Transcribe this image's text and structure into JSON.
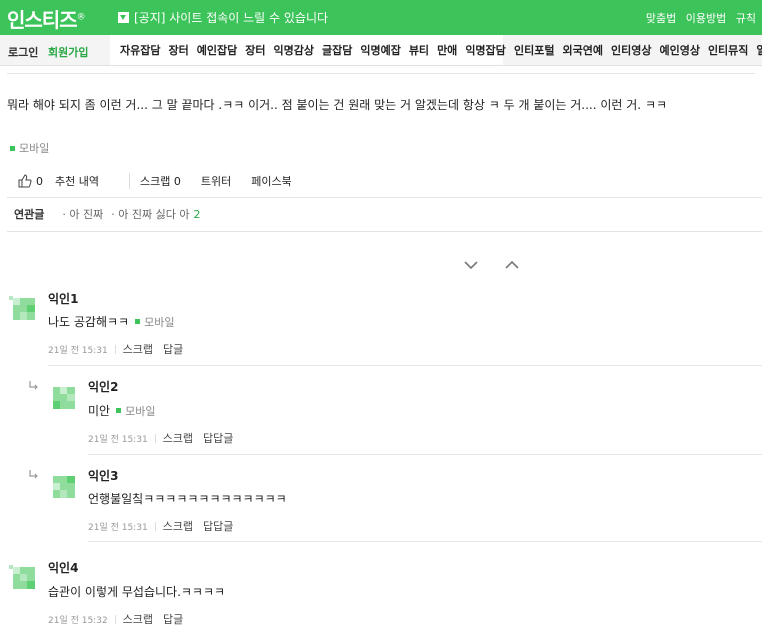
{
  "header": {
    "logo": "인스티즈",
    "logo_mark": "®",
    "notice": "[공지] 사이트 접속이 느릴 수 있습니다",
    "links": [
      "맞춤법",
      "이용방법",
      "규칙"
    ]
  },
  "nav": {
    "login": "로그인",
    "join": "회원가입",
    "menu": [
      "자유잡담",
      "장터",
      "예인잡담",
      "장터",
      "익명감상",
      "글잡담",
      "익명예잡",
      "뷰티",
      "만애",
      "익명잡담"
    ],
    "menu2": [
      "인티포털",
      "외국연예",
      "인티영상",
      "예인영상",
      "인티뮤직",
      "일정"
    ]
  },
  "post": {
    "body": "뭐라 해야 되지 좀 이런 거... 그 말 끝마다 .ㅋㅋ 이거.. 점 붙이는 건 원래 맞는 거 알겠는데 항상 ㅋ 두 개 붙이는 거.... 이런 거. ㅋㅋ",
    "device": "모바일",
    "like_count": "0",
    "actions": [
      "추천 내역",
      "스크랩 0",
      "트위터",
      "페이스북"
    ]
  },
  "related": {
    "label": "연관글",
    "items": [
      {
        "text": "· 아 진짜",
        "count": ""
      },
      {
        "text": "· 아 진짜 싫다 아",
        "count": "2"
      }
    ]
  },
  "comments": [
    {
      "name": "익인1",
      "text": "나도 공감해ㅋㅋ",
      "device": "모바일",
      "time": "21일 전 15:31",
      "scrap": "스크랩",
      "reply": "답글"
    },
    {
      "name": "익인2",
      "text": "미안",
      "device": "모바일",
      "time": "21일 전 15:31",
      "scrap": "스크랩",
      "reply": "답답글"
    },
    {
      "name": "익인3",
      "text": "언행불일칰ㅋㅋㅋㅋㅋㅋㅋㅋㅋㅋㅋㅋㅋ",
      "device": "",
      "time": "21일 전 15:31",
      "scrap": "스크랩",
      "reply": "답답글"
    },
    {
      "name": "익인4",
      "text": "습관이 이렇게 무섭습니다.ㅋㅋㅋㅋ",
      "device": "",
      "time": "21일 전 15:32",
      "scrap": "스크랩",
      "reply": "답글"
    }
  ],
  "colors": {
    "brand": "#3cc35a",
    "accent_text": "#2aa846"
  }
}
